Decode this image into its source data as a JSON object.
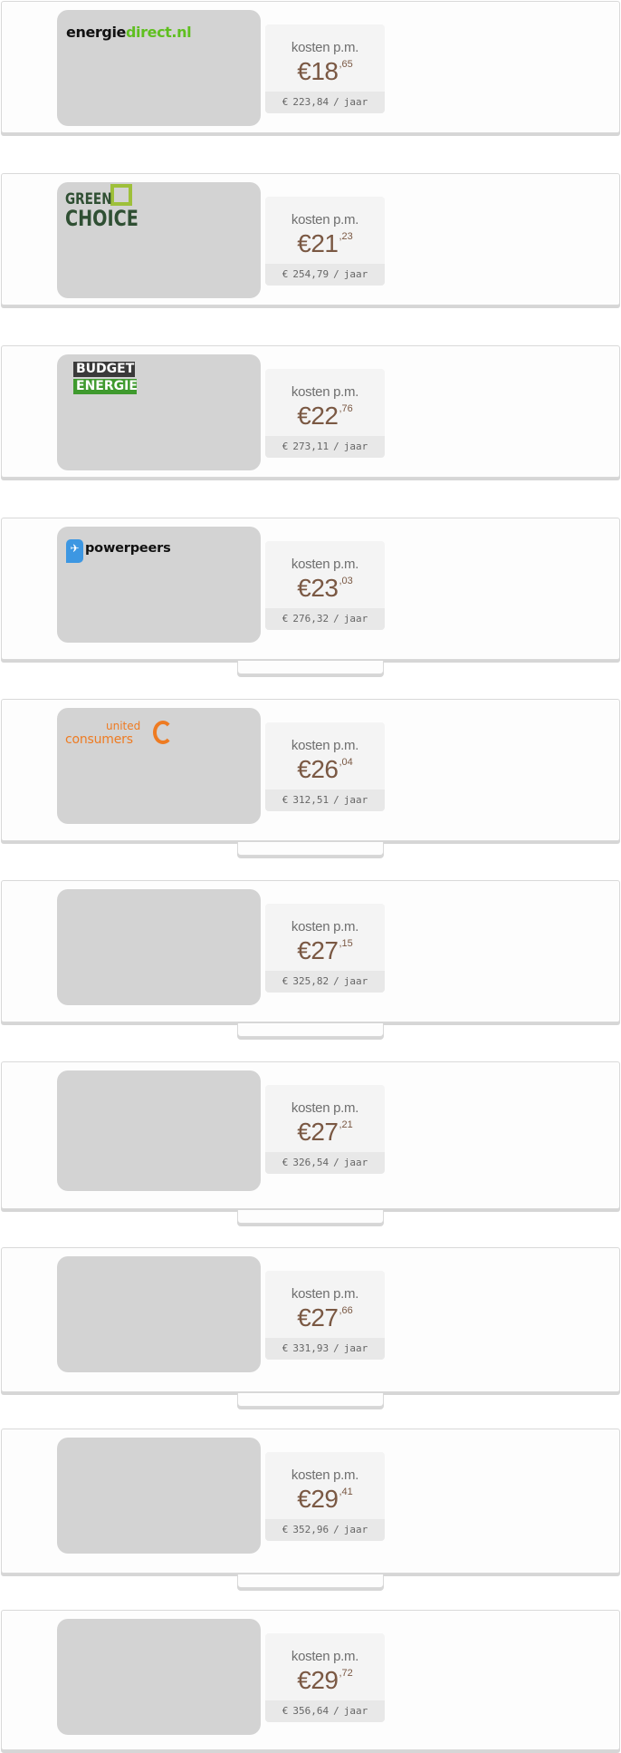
{
  "offers": [
    {
      "logo": "energiedirect",
      "logo_text": [
        "energie",
        "direct.nl"
      ],
      "label": "kosten p.m.",
      "currency": "€",
      "price_int": "18",
      "price_cents": ",65",
      "year_currency": "€",
      "year_amount": "223,84",
      "year_unit": "jaar"
    },
    {
      "logo": "greenchoice",
      "logo_text": [
        "GREEN",
        "CHOICE"
      ],
      "label": "kosten p.m.",
      "currency": "€",
      "price_int": "21",
      "price_cents": ",23",
      "year_currency": "€",
      "year_amount": "254,79",
      "year_unit": "jaar"
    },
    {
      "logo": "budgetenergie",
      "logo_text": [
        "BUDGET",
        "ENERGIE"
      ],
      "label": "kosten p.m.",
      "currency": "€",
      "price_int": "22",
      "price_cents": ",76",
      "year_currency": "€",
      "year_amount": "273,11",
      "year_unit": "jaar"
    },
    {
      "logo": "powerpeers",
      "logo_text": [
        "powerpeers"
      ],
      "label": "kosten p.m.",
      "currency": "€",
      "price_int": "23",
      "price_cents": ",03",
      "year_currency": "€",
      "year_amount": "276,32",
      "year_unit": "jaar"
    },
    {
      "logo": "unitedconsumers",
      "logo_text": [
        "united",
        "consumers"
      ],
      "label": "kosten p.m.",
      "currency": "€",
      "price_int": "26",
      "price_cents": ",04",
      "year_currency": "€",
      "year_amount": "312,51",
      "year_unit": "jaar"
    },
    {
      "logo": "",
      "label": "kosten p.m.",
      "currency": "€",
      "price_int": "27",
      "price_cents": ",15",
      "year_currency": "€",
      "year_amount": "325,82",
      "year_unit": "jaar"
    },
    {
      "logo": "",
      "label": "kosten p.m.",
      "currency": "€",
      "price_int": "27",
      "price_cents": ",21",
      "year_currency": "€",
      "year_amount": "326,54",
      "year_unit": "jaar"
    },
    {
      "logo": "",
      "label": "kosten p.m.",
      "currency": "€",
      "price_int": "27",
      "price_cents": ",66",
      "year_currency": "€",
      "year_amount": "331,93",
      "year_unit": "jaar"
    },
    {
      "logo": "",
      "label": "kosten p.m.",
      "currency": "€",
      "price_int": "29",
      "price_cents": ",41",
      "year_currency": "€",
      "year_amount": "352,96",
      "year_unit": "jaar"
    },
    {
      "logo": "",
      "label": "kosten p.m.",
      "currency": "€",
      "price_int": "29",
      "price_cents": ",72",
      "year_currency": "€",
      "year_amount": "356,64",
      "year_unit": "jaar"
    }
  ],
  "colors": {
    "price": "#7a5843",
    "logo_placeholder": "#d3d3d3",
    "energiedirect_green": "#5fbf1f",
    "greenchoice_green": "#2f4f33",
    "budget_green": "#3f9a2e",
    "powerpeers_blue": "#3d97e2",
    "unitedconsumers_orange": "#ee7b22"
  }
}
